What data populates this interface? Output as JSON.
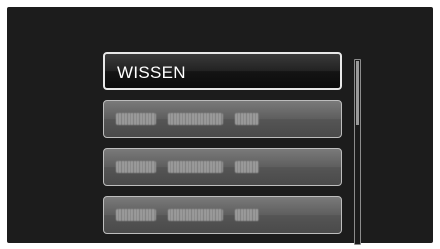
{
  "menu": {
    "items": [
      {
        "label": "WISSEN",
        "selected": true
      },
      {
        "label": "",
        "selected": false,
        "content": "blurred"
      },
      {
        "label": "",
        "selected": false,
        "content": "blurred"
      },
      {
        "label": "",
        "selected": false,
        "content": "blurred"
      }
    ]
  },
  "scrollbar": {
    "position_fraction": 0.0,
    "visible_fraction": 0.35
  },
  "colors": {
    "screen_background": "#1c1c1c",
    "selected_item_background": "#141414",
    "item_background": "#5e5e5e",
    "item_border": "#bdbdbd",
    "text": "#ffffff"
  }
}
